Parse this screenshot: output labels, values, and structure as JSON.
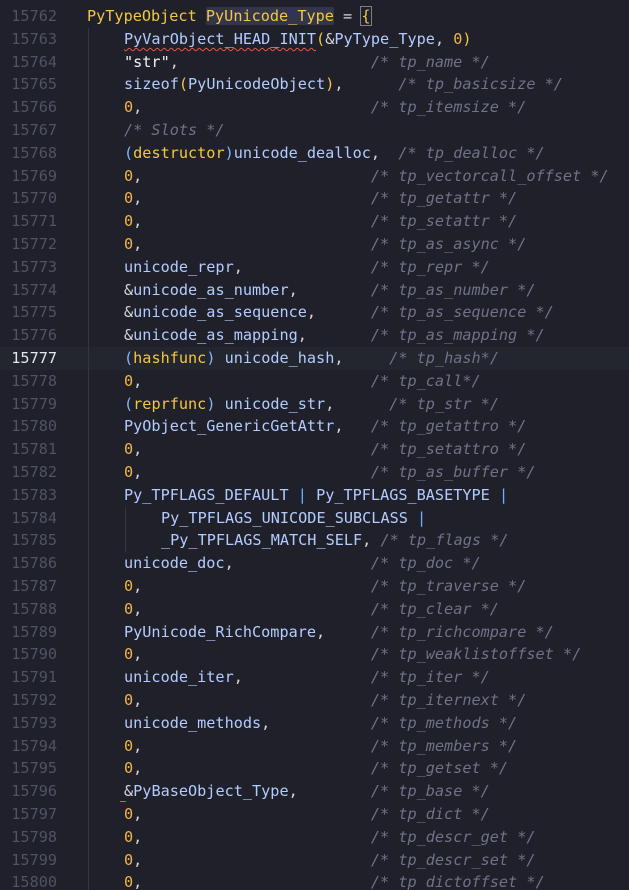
{
  "editor": {
    "active_line": "15777",
    "lines": [
      {
        "ln": "15762",
        "parts": [
          [
            "k-type",
            "PyTypeObject"
          ],
          [
            "k-plain",
            " "
          ],
          [
            "k-type hl-word",
            "PyUnicode_Type"
          ],
          [
            "k-plain",
            " = "
          ],
          [
            "k-bracket brace-box",
            "{"
          ]
        ]
      },
      {
        "ln": "15763",
        "parts": [
          [
            "k-macro squiggle",
            "PyVarObject_HEAD_INIT"
          ],
          [
            "k-bracket",
            "("
          ],
          [
            "k-plain",
            "&"
          ],
          [
            "k-func",
            "PyType_Type"
          ],
          [
            "k-plain",
            ", "
          ],
          [
            "k-num",
            "0"
          ],
          [
            "k-bracket",
            ")"
          ]
        ]
      },
      {
        "ln": "15764",
        "parts": [
          [
            "k-str",
            "\"str\""
          ],
          [
            "k-plain",
            ",                     "
          ],
          [
            "k-cmt",
            "/* tp_name */"
          ]
        ]
      },
      {
        "ln": "15765",
        "parts": [
          [
            "k-func",
            "sizeof"
          ],
          [
            "k-bracket",
            "("
          ],
          [
            "k-func",
            "PyUnicodeObject"
          ],
          [
            "k-bracket",
            ")"
          ],
          [
            "k-plain",
            ",      "
          ],
          [
            "k-cmt",
            "/* tp_basicsize */"
          ]
        ]
      },
      {
        "ln": "15766",
        "parts": [
          [
            "k-num",
            "0"
          ],
          [
            "k-plain",
            ",                         "
          ],
          [
            "k-cmt",
            "/* tp_itemsize */"
          ]
        ]
      },
      {
        "ln": "15767",
        "parts": [
          [
            "k-cmt",
            "/* Slots */"
          ]
        ]
      },
      {
        "ln": "15768",
        "parts": [
          [
            "k-cast",
            "("
          ],
          [
            "k-type",
            "destructor"
          ],
          [
            "k-cast",
            ")"
          ],
          [
            "k-func",
            "unicode_dealloc"
          ],
          [
            "k-plain",
            ",  "
          ],
          [
            "k-cmt",
            "/* tp_dealloc */"
          ]
        ]
      },
      {
        "ln": "15769",
        "parts": [
          [
            "k-num",
            "0"
          ],
          [
            "k-plain",
            ",                         "
          ],
          [
            "k-cmt",
            "/* tp_vectorcall_offset */"
          ]
        ]
      },
      {
        "ln": "15770",
        "parts": [
          [
            "k-num",
            "0"
          ],
          [
            "k-plain",
            ",                         "
          ],
          [
            "k-cmt",
            "/* tp_getattr */"
          ]
        ]
      },
      {
        "ln": "15771",
        "parts": [
          [
            "k-num",
            "0"
          ],
          [
            "k-plain",
            ",                         "
          ],
          [
            "k-cmt",
            "/* tp_setattr */"
          ]
        ]
      },
      {
        "ln": "15772",
        "parts": [
          [
            "k-num",
            "0"
          ],
          [
            "k-plain",
            ",                         "
          ],
          [
            "k-cmt",
            "/* tp_as_async */"
          ]
        ]
      },
      {
        "ln": "15773",
        "parts": [
          [
            "k-func",
            "unicode_repr"
          ],
          [
            "k-plain",
            ",              "
          ],
          [
            "k-cmt",
            "/* tp_repr */"
          ]
        ]
      },
      {
        "ln": "15774",
        "parts": [
          [
            "k-plain",
            "&"
          ],
          [
            "k-func",
            "unicode_as_number"
          ],
          [
            "k-plain",
            ",        "
          ],
          [
            "k-cmt",
            "/* tp_as_number */"
          ]
        ]
      },
      {
        "ln": "15775",
        "parts": [
          [
            "k-plain",
            "&"
          ],
          [
            "k-func",
            "unicode_as_sequence"
          ],
          [
            "k-plain",
            ",      "
          ],
          [
            "k-cmt",
            "/* tp_as_sequence */"
          ]
        ]
      },
      {
        "ln": "15776",
        "parts": [
          [
            "k-plain",
            "&"
          ],
          [
            "k-func",
            "unicode_as_mapping"
          ],
          [
            "k-plain",
            ",       "
          ],
          [
            "k-cmt",
            "/* tp_as_mapping */"
          ]
        ]
      },
      {
        "ln": "15777",
        "parts": [
          [
            "k-cast",
            "("
          ],
          [
            "k-type",
            "hashfunc"
          ],
          [
            "k-cast",
            ")"
          ],
          [
            "k-plain",
            " "
          ],
          [
            "k-func",
            "unicode_hash"
          ],
          [
            "k-plain",
            ",     "
          ],
          [
            "k-cmt",
            "/* tp_hash*/"
          ]
        ]
      },
      {
        "ln": "15778",
        "parts": [
          [
            "k-num",
            "0"
          ],
          [
            "k-plain",
            ",                         "
          ],
          [
            "k-cmt",
            "/* tp_call*/"
          ]
        ]
      },
      {
        "ln": "15779",
        "parts": [
          [
            "k-cast",
            "("
          ],
          [
            "k-type",
            "reprfunc"
          ],
          [
            "k-cast",
            ")"
          ],
          [
            "k-plain",
            " "
          ],
          [
            "k-func",
            "unicode_str"
          ],
          [
            "k-plain",
            ",      "
          ],
          [
            "k-cmt",
            "/* tp_str */"
          ]
        ]
      },
      {
        "ln": "15780",
        "parts": [
          [
            "k-func",
            "PyObject_GenericGetAttr"
          ],
          [
            "k-plain",
            ",   "
          ],
          [
            "k-cmt",
            "/* tp_getattro */"
          ]
        ]
      },
      {
        "ln": "15781",
        "parts": [
          [
            "k-num",
            "0"
          ],
          [
            "k-plain",
            ",                         "
          ],
          [
            "k-cmt",
            "/* tp_setattro */"
          ]
        ]
      },
      {
        "ln": "15782",
        "parts": [
          [
            "k-num",
            "0"
          ],
          [
            "k-plain",
            ",                         "
          ],
          [
            "k-cmt",
            "/* tp_as_buffer */"
          ]
        ]
      },
      {
        "ln": "15783",
        "parts": [
          [
            "k-macro",
            "Py_TPFLAGS_DEFAULT"
          ],
          [
            "k-plain",
            " "
          ],
          [
            "k-op",
            "|"
          ],
          [
            "k-plain",
            " "
          ],
          [
            "k-macro",
            "Py_TPFLAGS_BASETYPE"
          ],
          [
            "k-plain",
            " "
          ],
          [
            "k-op",
            "|"
          ]
        ]
      },
      {
        "ln": "15784",
        "indent": true,
        "parts": [
          [
            "k-macro",
            "Py_TPFLAGS_UNICODE_SUBCLASS"
          ],
          [
            "k-plain",
            " "
          ],
          [
            "k-op",
            "|"
          ]
        ]
      },
      {
        "ln": "15785",
        "indent": true,
        "parts": [
          [
            "k-macro",
            "_Py_TPFLAGS_MATCH_SELF"
          ],
          [
            "k-plain",
            ", "
          ],
          [
            "k-cmt",
            "/* tp_flags */"
          ]
        ]
      },
      {
        "ln": "15786",
        "parts": [
          [
            "k-func",
            "unicode_doc"
          ],
          [
            "k-plain",
            ",               "
          ],
          [
            "k-cmt",
            "/* tp_doc */"
          ]
        ]
      },
      {
        "ln": "15787",
        "parts": [
          [
            "k-num",
            "0"
          ],
          [
            "k-plain",
            ",                         "
          ],
          [
            "k-cmt",
            "/* tp_traverse */"
          ]
        ]
      },
      {
        "ln": "15788",
        "parts": [
          [
            "k-num",
            "0"
          ],
          [
            "k-plain",
            ",                         "
          ],
          [
            "k-cmt",
            "/* tp_clear */"
          ]
        ]
      },
      {
        "ln": "15789",
        "parts": [
          [
            "k-func",
            "PyUnicode_RichCompare"
          ],
          [
            "k-plain",
            ",     "
          ],
          [
            "k-cmt",
            "/* tp_richcompare */"
          ]
        ]
      },
      {
        "ln": "15790",
        "parts": [
          [
            "k-num",
            "0"
          ],
          [
            "k-plain",
            ",                         "
          ],
          [
            "k-cmt",
            "/* tp_weaklistoffset */"
          ]
        ]
      },
      {
        "ln": "15791",
        "parts": [
          [
            "k-func",
            "unicode_iter"
          ],
          [
            "k-plain",
            ",              "
          ],
          [
            "k-cmt",
            "/* tp_iter */"
          ]
        ]
      },
      {
        "ln": "15792",
        "parts": [
          [
            "k-num",
            "0"
          ],
          [
            "k-plain",
            ",                         "
          ],
          [
            "k-cmt",
            "/* tp_iternext */"
          ]
        ]
      },
      {
        "ln": "15793",
        "parts": [
          [
            "k-func",
            "unicode_methods"
          ],
          [
            "k-plain",
            ",           "
          ],
          [
            "k-cmt",
            "/* tp_methods */"
          ]
        ]
      },
      {
        "ln": "15794",
        "parts": [
          [
            "k-num",
            "0"
          ],
          [
            "k-plain",
            ",                         "
          ],
          [
            "k-cmt",
            "/* tp_members */"
          ]
        ]
      },
      {
        "ln": "15795",
        "parts": [
          [
            "k-num",
            "0"
          ],
          [
            "k-plain",
            ",                         "
          ],
          [
            "k-cmt",
            "/* tp_getset */"
          ]
        ]
      },
      {
        "ln": "15796",
        "parts": [
          [
            "k-plain",
            "&"
          ],
          [
            "k-func",
            "PyBaseObject_Type"
          ],
          [
            "k-plain",
            ",        "
          ],
          [
            "k-cmt",
            "/* tp_base */"
          ]
        ]
      },
      {
        "ln": "15797",
        "parts": [
          [
            "k-num",
            "0"
          ],
          [
            "k-plain",
            ",                         "
          ],
          [
            "k-cmt",
            "/* tp_dict */"
          ]
        ]
      },
      {
        "ln": "15798",
        "parts": [
          [
            "k-num",
            "0"
          ],
          [
            "k-plain",
            ",                         "
          ],
          [
            "k-cmt",
            "/* tp_descr_get */"
          ]
        ]
      },
      {
        "ln": "15799",
        "parts": [
          [
            "k-num",
            "0"
          ],
          [
            "k-plain",
            ",                         "
          ],
          [
            "k-cmt",
            "/* tp_descr_set */"
          ]
        ]
      },
      {
        "ln": "15800",
        "parts": [
          [
            "k-num",
            "0"
          ],
          [
            "k-plain",
            ",                         "
          ],
          [
            "k-cmt",
            "/* tp_dictoffset */"
          ]
        ]
      }
    ]
  }
}
